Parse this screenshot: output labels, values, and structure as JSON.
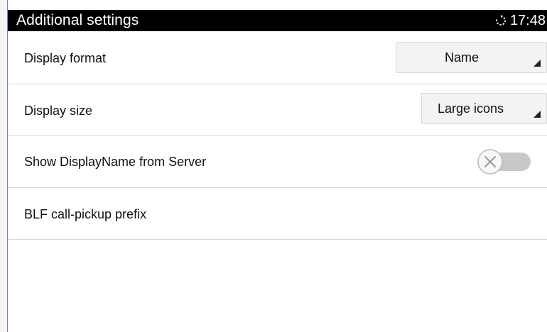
{
  "status_bar": {
    "title": "Additional settings",
    "time": "17:48",
    "sync_icon": "sync-icon"
  },
  "settings": {
    "display_format": {
      "label": "Display format",
      "value": "Name"
    },
    "display_size": {
      "label": "Display size",
      "value": "Large icons"
    },
    "show_display_name": {
      "label": "Show DisplayName from Server",
      "state": "off"
    },
    "blf_prefix": {
      "label": "BLF call-pickup prefix"
    }
  },
  "colors": {
    "status_bar_bg": "#000000",
    "divider": "#d7d7d7",
    "toggle_off": "#c8c8c8"
  }
}
